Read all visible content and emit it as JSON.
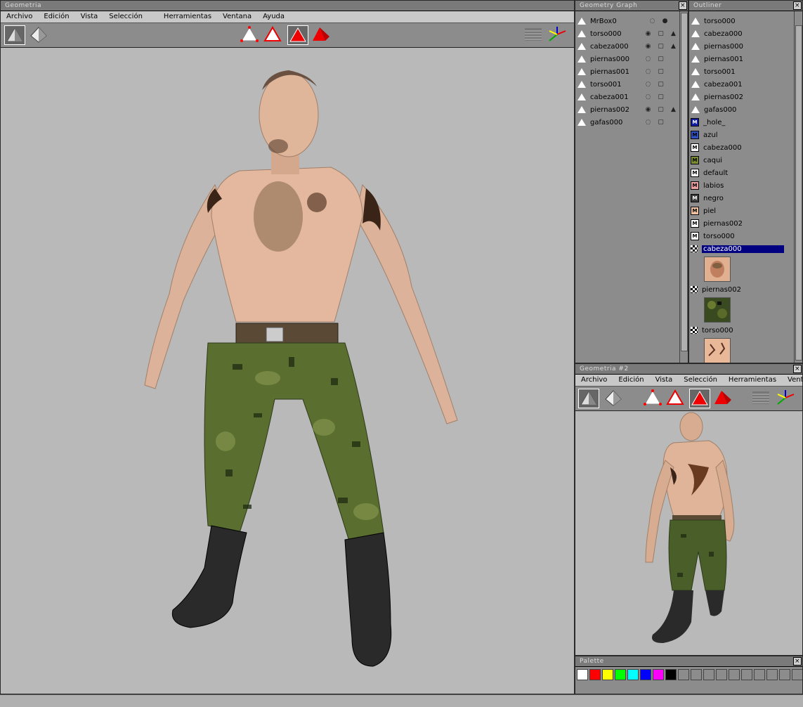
{
  "main_window": {
    "title": "Geometria",
    "menu": [
      "Archivo",
      "Edición",
      "Vista",
      "Selección",
      "Herramientas",
      "Ventana",
      "Ayuda"
    ]
  },
  "geometry_graph": {
    "title": "Geometry Graph",
    "items": [
      {
        "name": "MrBox0"
      },
      {
        "name": "torso000"
      },
      {
        "name": "cabeza000"
      },
      {
        "name": "piernas000"
      },
      {
        "name": "piernas001"
      },
      {
        "name": "torso001"
      },
      {
        "name": "cabeza001"
      },
      {
        "name": "piernas002"
      },
      {
        "name": "gafas000"
      }
    ]
  },
  "outliner": {
    "title": "Outliner",
    "objects": [
      "torso000",
      "cabeza000",
      "piernas000",
      "piernas001",
      "torso001",
      "cabeza001",
      "piernas002",
      "gafas000"
    ],
    "materials": [
      {
        "name": "_hole_",
        "color": "#1020a0"
      },
      {
        "name": "azul",
        "color": "#3050c0"
      },
      {
        "name": "cabeza000",
        "color": "#ffffff"
      },
      {
        "name": "caqui",
        "color": "#7a8a30"
      },
      {
        "name": "default",
        "color": "#ffffff"
      },
      {
        "name": "labios",
        "color": "#e8a0a0"
      },
      {
        "name": "negro",
        "color": "#404040"
      },
      {
        "name": "piel",
        "color": "#f0c0a0"
      },
      {
        "name": "piernas002",
        "color": "#ffffff"
      },
      {
        "name": "torso000",
        "color": "#ffffff"
      }
    ],
    "textures": [
      "cabeza000",
      "piernas002",
      "torso000"
    ],
    "selected_texture": "cabeza000"
  },
  "second_window": {
    "title": "Geometria #2",
    "menu": [
      "Archivo",
      "Edición",
      "Vista",
      "Selección",
      "Herramientas",
      "Ventana"
    ]
  },
  "palette": {
    "title": "Palette",
    "colors": [
      "#ffffff",
      "#ff0000",
      "#ffff00",
      "#00ff00",
      "#00ffff",
      "#0000ff",
      "#ff00ff",
      "#000000",
      "#8c8c8c",
      "#8c8c8c",
      "#8c8c8c",
      "#8c8c8c",
      "#8c8c8c",
      "#8c8c8c",
      "#8c8c8c",
      "#8c8c8c",
      "#8c8c8c",
      "#8c8c8c"
    ]
  },
  "colors": {
    "selection": "#000080",
    "viewport_bg": "#b9b9b9",
    "panel_bg": "#8c8c8c"
  },
  "icons": {
    "shaded_mode": "cone-shaded-icon",
    "wire_mode": "cone-wire-icon",
    "vertex_select": "triangle-vertex-icon",
    "edge_select": "triangle-edge-icon",
    "face_select": "triangle-face-icon",
    "object_select": "triangle-object-icon",
    "grid": "grid-icon",
    "axes": "axes-icon"
  }
}
